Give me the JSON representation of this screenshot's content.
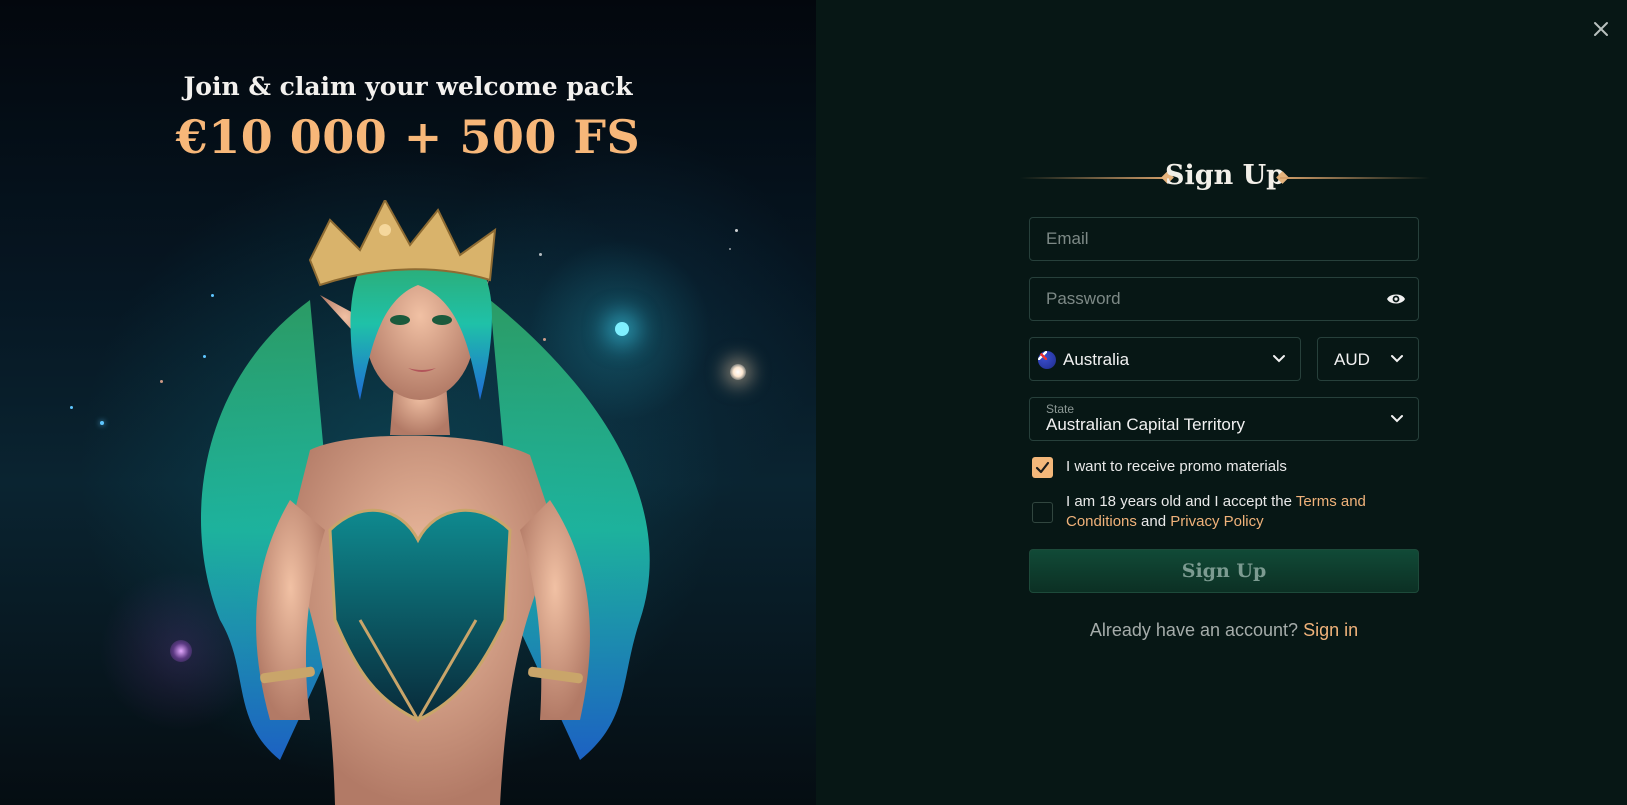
{
  "promo": {
    "title": "Join & claim your welcome pack",
    "amount": "€10 000 + 500 FS"
  },
  "form": {
    "heading": "Sign Up",
    "email_placeholder": "Email",
    "password_placeholder": "Password",
    "country": "Australia",
    "currency": "AUD",
    "state_label": "State",
    "state_value": "Australian Capital Territory",
    "promo_checkbox": {
      "label": "I want to receive promo materials",
      "checked": true
    },
    "terms_checkbox": {
      "prefix": "I am 18 years old and I accept the ",
      "terms_link": "Terms and Conditions",
      "and": " and ",
      "privacy_link": "Privacy Policy",
      "checked": false
    },
    "submit_label": "Sign Up",
    "signin_prompt": "Already have an account?",
    "signin_link": "Sign in"
  },
  "icons": {
    "close": "close-icon",
    "eye": "eye-icon",
    "chevron": "chevron-down-icon",
    "flag": "australia-flag-icon",
    "check": "check-icon"
  },
  "colors": {
    "accent": "#f3b77a",
    "panel_bg": "#071715",
    "submit_bg": "#114a37"
  }
}
